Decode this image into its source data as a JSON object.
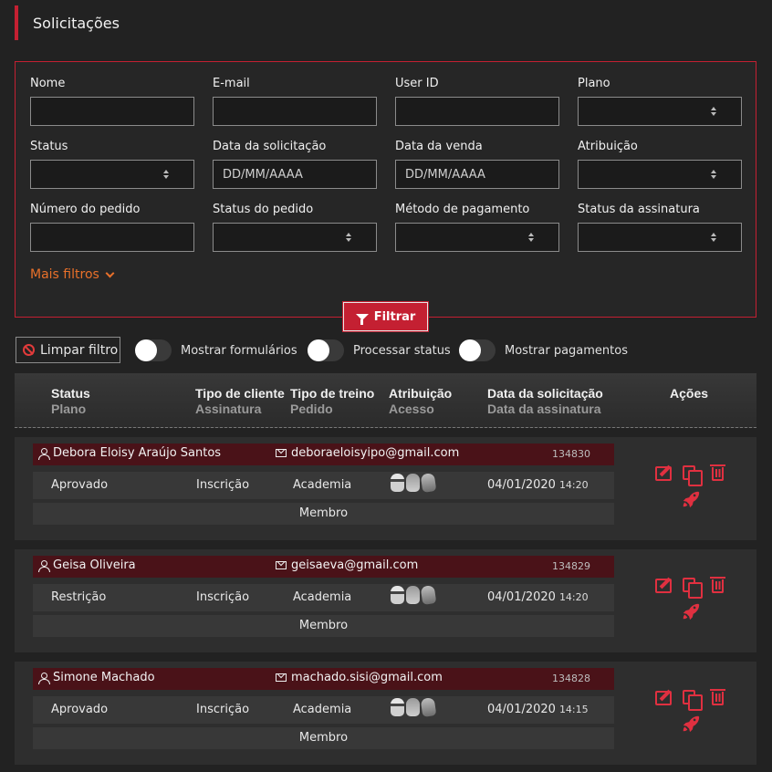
{
  "page": {
    "title": "Solicitações"
  },
  "filters": {
    "fields": [
      {
        "label": "Nome",
        "type": "text",
        "placeholder": ""
      },
      {
        "label": "E-mail",
        "type": "text",
        "placeholder": ""
      },
      {
        "label": "User ID",
        "type": "text",
        "placeholder": ""
      },
      {
        "label": "Plano",
        "type": "select",
        "placeholder": ""
      },
      {
        "label": "Status",
        "type": "select",
        "placeholder": ""
      },
      {
        "label": "Data da solicitação",
        "type": "text",
        "placeholder": "DD/MM/AAAA"
      },
      {
        "label": "Data da venda",
        "type": "text",
        "placeholder": "DD/MM/AAAA"
      },
      {
        "label": "Atribuição",
        "type": "select",
        "placeholder": ""
      },
      {
        "label": "Número do pedido",
        "type": "text",
        "placeholder": ""
      },
      {
        "label": "Status do pedido",
        "type": "select",
        "placeholder": ""
      },
      {
        "label": "Método de pagamento",
        "type": "select",
        "placeholder": ""
      },
      {
        "label": "Status da assinatura",
        "type": "select",
        "placeholder": ""
      }
    ],
    "more_filters": "Mais filtros",
    "filter_button": "Filtrar"
  },
  "toolbar": {
    "clear_filter": "Limpar filtro",
    "toggles": [
      {
        "label": "Mostrar formulários",
        "on": false
      },
      {
        "label": "Processar status",
        "on": false
      },
      {
        "label": "Mostrar pagamentos",
        "on": false
      }
    ]
  },
  "table": {
    "headers": [
      {
        "main": "Status",
        "sub": "Plano"
      },
      {
        "main": "Tipo de cliente",
        "sub": "Assinatura"
      },
      {
        "main": "Tipo de treino",
        "sub": "Pedido"
      },
      {
        "main": "Atribuição",
        "sub": "Acesso"
      },
      {
        "main": "Data da solicitação",
        "sub": "Data da assinatura"
      },
      {
        "main": "Ações",
        "sub": ""
      }
    ],
    "rows": [
      {
        "name": "Debora Eloisy Araújo Santos",
        "email": "deboraeloisyipo@gmail.com",
        "id": "134830",
        "status": "Aprovado",
        "client_type": "Inscrição",
        "training": "Academia",
        "date": "04/01/2020",
        "time": "14:20",
        "plan": "Membro"
      },
      {
        "name": "Geisa Oliveira",
        "email": "geisaeva@gmail.com",
        "id": "134829",
        "status": "Restrição",
        "client_type": "Inscrição",
        "training": "Academia",
        "date": "04/01/2020",
        "time": "14:20",
        "plan": "Membro"
      },
      {
        "name": "Simone Machado",
        "email": "machado.sisi@gmail.com",
        "id": "134828",
        "status": "Aprovado",
        "client_type": "Inscrição",
        "training": "Academia",
        "date": "04/01/2020",
        "time": "14:15",
        "plan": "Membro"
      }
    ]
  },
  "colors": {
    "accent": "#c42032",
    "orange": "#e8702a",
    "name_bar": "#4a1218",
    "background": "#222222"
  },
  "icons": [
    "ban-icon",
    "funnel-icon",
    "chevron-down-icon",
    "user-icon",
    "mail-icon",
    "edit-icon",
    "copy-icon",
    "trash-icon",
    "rocket-icon"
  ]
}
